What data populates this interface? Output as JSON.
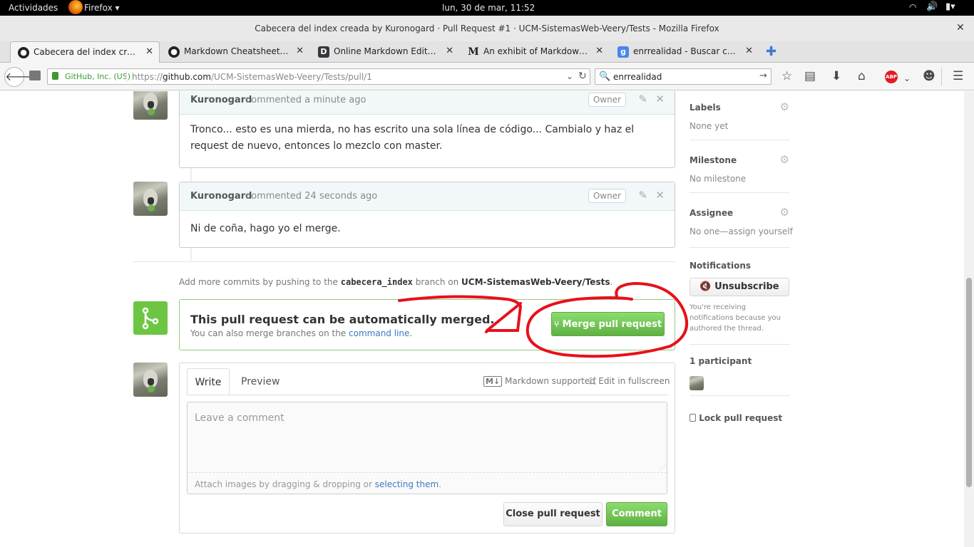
{
  "system_bar": {
    "activities": "Actividades",
    "app_menu": "Firefox",
    "clock": "lun, 30 de mar, 11:52"
  },
  "window": {
    "title": "Cabecera del index creada by Kuronogard · Pull Request #1 · UCM-SistemasWeb-Veery/Tests - Mozilla Firefox"
  },
  "tabs": [
    {
      "label": "Cabecera del index creada by Kuronogard",
      "icon": "github-icon"
    },
    {
      "label": "Markdown Cheatsheet · adam-p",
      "icon": "github-icon"
    },
    {
      "label": "Online Markdown Editor - Dillinger",
      "icon": "dillinger-icon",
      "icon_text": "D"
    },
    {
      "label": "An exhibit of Markdown — Markdown",
      "icon": "medium-icon",
      "icon_text": "M"
    },
    {
      "label": "enrrealidad - Buscar con Google",
      "icon": "google-icon",
      "icon_text": "g"
    }
  ],
  "nav": {
    "identity": "GitHub, Inc. (US)",
    "url_prefix": "https://",
    "url_domain": "github.com",
    "url_path": "/UCM-SistemasWeb-Veery/Tests/pull/1",
    "search_value": "enrrealidad",
    "abp_label": "ABP"
  },
  "comments": [
    {
      "author": "Kuronogard",
      "time": "commented a minute ago",
      "badge": "Owner",
      "body": "Tronco... esto es una mierda, no has escrito una sola línea de código... Cambialo y haz el request de nuevo, entonces lo mezclo con master."
    },
    {
      "author": "Kuronogard",
      "time": "commented 24 seconds ago",
      "badge": "Owner",
      "body": "Ni de coña, hago yo el merge."
    }
  ],
  "push_hint": {
    "prefix": "Add more commits by pushing to the",
    "branch": "cabecera_index",
    "middle": "branch on",
    "repo": "UCM-SistemasWeb-Veery/Tests",
    "suffix": "."
  },
  "merge": {
    "title": "This pull request can be automatically merged.",
    "subtitle_prefix": "You can also merge branches on the",
    "subtitle_link": "command line",
    "subtitle_suffix": ".",
    "button": "Merge pull request"
  },
  "editor": {
    "tab_write": "Write",
    "tab_preview": "Preview",
    "markdown_hint": "Markdown supported",
    "fullscreen": "Edit in fullscreen",
    "placeholder": "Leave a comment",
    "attach_prefix": "Attach images by dragging & dropping or",
    "attach_link": "selecting them",
    "attach_suffix": ".",
    "close_button": "Close pull request",
    "comment_button": "Comment"
  },
  "sidebar": {
    "labels_title": "Labels",
    "labels_value": "None yet",
    "milestone_title": "Milestone",
    "milestone_value": "No milestone",
    "assignee_title": "Assignee",
    "assignee_value": "No one—assign yourself",
    "notifications_title": "Notifications",
    "unsubscribe": "Unsubscribe",
    "notif_note": "You're receiving notifications because you authored the thread.",
    "participants": "1 participant",
    "lock": "Lock pull request"
  },
  "colors": {
    "annotation_red": "#e8101a",
    "merge_green": "#6cc644",
    "link_blue": "#4078c0"
  }
}
